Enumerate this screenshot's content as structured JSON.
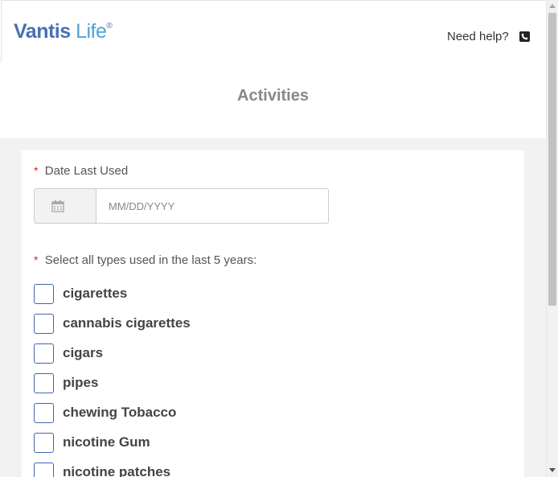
{
  "brand": {
    "logo_part1": "Vantis",
    "logo_part2": " Life",
    "logo_mark": "®"
  },
  "header": {
    "help_label": "Need help?",
    "help_icon": "phone-icon"
  },
  "page": {
    "title": "Activities"
  },
  "form": {
    "required_marker": "*",
    "date_field": {
      "label": "Date Last Used",
      "placeholder": "MM/DD/YYYY",
      "value": "",
      "icon": "calendar-icon"
    },
    "types_field": {
      "label": "Select all types used in the last 5 years:",
      "options": [
        {
          "label": "cigarettes",
          "checked": false
        },
        {
          "label": "cannabis cigarettes",
          "checked": false
        },
        {
          "label": "cigars",
          "checked": false
        },
        {
          "label": "pipes",
          "checked": false
        },
        {
          "label": "chewing Tobacco",
          "checked": false
        },
        {
          "label": "nicotine Gum",
          "checked": false
        },
        {
          "label": "nicotine patches",
          "checked": false
        }
      ]
    }
  },
  "colors": {
    "brand_dark": "#4a6fb3",
    "brand_light": "#4ea3d9",
    "required": "#d9261c",
    "checkbox_border": "#3f66b0"
  }
}
